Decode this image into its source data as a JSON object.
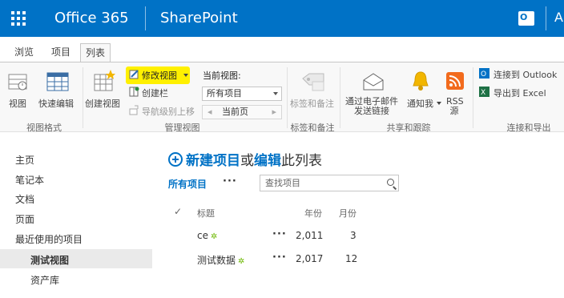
{
  "suite": {
    "app_name": "Office 365",
    "product": "SharePoint",
    "user_fragment": "A"
  },
  "tabs": [
    {
      "label": "浏览"
    },
    {
      "label": "项目"
    },
    {
      "label": "列表"
    }
  ],
  "ribbon": {
    "view_format": {
      "view": "视图",
      "quick_edit": "快速编辑",
      "group": "视图格式"
    },
    "manage_views": {
      "create_view": "创建视图",
      "modify_view": "修改视图",
      "create_column": "创建栏",
      "navigate_up": "导航级别上移",
      "current_view_label": "当前视图:",
      "current_view_value": "所有项目",
      "current_page": "当前页",
      "group": "管理视图"
    },
    "tags_notes": {
      "label": "标签和备注",
      "group": "标签和备注"
    },
    "share_track": {
      "email_link_line1": "通过电子邮件",
      "email_link_line2": "发送链接",
      "alert_me": "通知我",
      "rss_line1": "RSS",
      "rss_line2": "源",
      "group": "共享和跟踪"
    },
    "connect_export": {
      "connect_outlook": "连接到 Outlook",
      "export_excel": "导出到 Excel",
      "group": "连接和导出"
    }
  },
  "nav": {
    "items": [
      "主页",
      "笔记本",
      "文档",
      "页面",
      "最近使用的项目",
      "测试视图",
      "资产库"
    ],
    "selected_index": 5
  },
  "main": {
    "new_item": "新建项目",
    "or": "或",
    "edit": "编辑",
    "this_list": "此列表",
    "view_name": "所有项目",
    "ellipsis": "···",
    "search_placeholder": "查找项目",
    "columns": {
      "title": "标题",
      "year": "年份",
      "month": "月份"
    },
    "rows": [
      {
        "title": "ce",
        "year": "2,011",
        "month": "3"
      },
      {
        "title": "测试数据",
        "year": "2,017",
        "month": "12"
      }
    ]
  },
  "colors": {
    "suite_blue": "#0072c6",
    "highlight": "#fff000",
    "new_badge": "#6bb700"
  }
}
